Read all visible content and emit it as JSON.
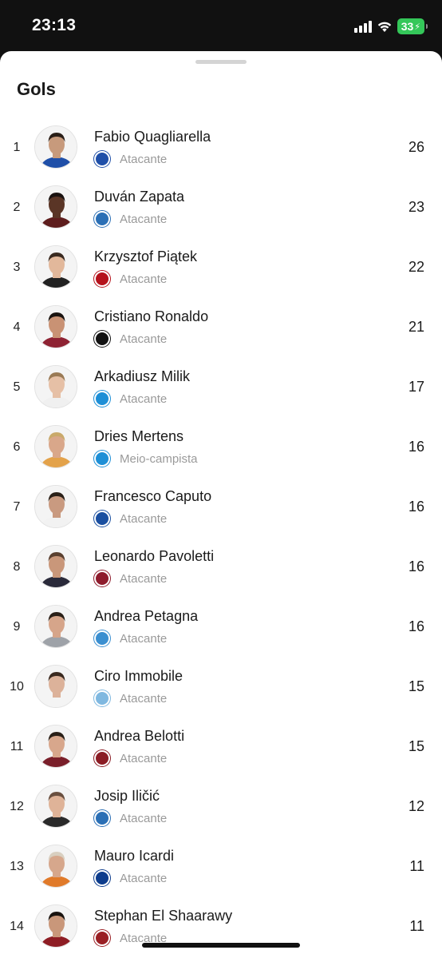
{
  "status": {
    "time": "23:13",
    "battery": "33"
  },
  "sheet": {
    "title": "Gols"
  },
  "players": [
    {
      "rank": "1",
      "name": "Fabio Quagliarella",
      "position": "Atacante",
      "goals": "26",
      "club_color": "#1f4fa8",
      "club_icon": "sampdoria-crest-icon",
      "skin": "#c79a7c",
      "hair": "#2a1f18",
      "shirt": "#1f4fa8"
    },
    {
      "rank": "2",
      "name": "Duván Zapata",
      "position": "Atacante",
      "goals": "23",
      "club_color": "#2b6fb5",
      "club_icon": "atalanta-crest-icon",
      "skin": "#5a3526",
      "hair": "#1a1210",
      "shirt": "#5e1d1d"
    },
    {
      "rank": "3",
      "name": "Krzysztof Piątek",
      "position": "Atacante",
      "goals": "22",
      "club_color": "#b5121b",
      "club_icon": "milan-crest-icon",
      "skin": "#e2b89b",
      "hair": "#3a2a20",
      "shirt": "#222222"
    },
    {
      "rank": "4",
      "name": "Cristiano Ronaldo",
      "position": "Atacante",
      "goals": "21",
      "club_color": "#111111",
      "club_icon": "juventus-crest-icon",
      "skin": "#c99274",
      "hair": "#1a1410",
      "shirt": "#8e2233"
    },
    {
      "rank": "5",
      "name": "Arkadiusz Milik",
      "position": "Atacante",
      "goals": "17",
      "club_color": "#1e8fd6",
      "club_icon": "napoli-crest-icon",
      "skin": "#e6c0a6",
      "hair": "#9a7a55",
      "shirt": "#f0f0f0"
    },
    {
      "rank": "6",
      "name": "Dries Mertens",
      "position": "Meio-campista",
      "goals": "16",
      "club_color": "#1e8fd6",
      "club_icon": "napoli-crest-icon",
      "skin": "#d9a78a",
      "hair": "#c9a96a",
      "shirt": "#e3a24a"
    },
    {
      "rank": "7",
      "name": "Francesco Caputo",
      "position": "Atacante",
      "goals": "16",
      "club_color": "#1a4fa0",
      "club_icon": "empoli-crest-icon",
      "skin": "#c99a80",
      "hair": "#2a2018",
      "shirt": "#f2f2f2"
    },
    {
      "rank": "8",
      "name": "Leonardo Pavoletti",
      "position": "Atacante",
      "goals": "16",
      "club_color": "#8e1b2c",
      "club_icon": "cagliari-crest-icon",
      "skin": "#c9977a",
      "hair": "#5a4030",
      "shirt": "#2a2a3a"
    },
    {
      "rank": "9",
      "name": "Andrea Petagna",
      "position": "Atacante",
      "goals": "16",
      "club_color": "#3b8fd0",
      "club_icon": "spal-crest-icon",
      "skin": "#d6a58a",
      "hair": "#2a2018",
      "shirt": "#9ea2a8"
    },
    {
      "rank": "10",
      "name": "Ciro Immobile",
      "position": "Atacante",
      "goals": "15",
      "club_color": "#7fb8e0",
      "club_icon": "lazio-crest-icon",
      "skin": "#dcb29a",
      "hair": "#3a2a20",
      "shirt": "#f4f4f4"
    },
    {
      "rank": "11",
      "name": "Andrea Belotti",
      "position": "Atacante",
      "goals": "15",
      "club_color": "#8b1c24",
      "club_icon": "torino-crest-icon",
      "skin": "#d8a78c",
      "hair": "#2a2018",
      "shirt": "#7a1f2a"
    },
    {
      "rank": "12",
      "name": "Josip Iličić",
      "position": "Atacante",
      "goals": "12",
      "club_color": "#2b6fb5",
      "club_icon": "atalanta-crest-icon",
      "skin": "#dfb398",
      "hair": "#6a5040",
      "shirt": "#2a2a2a"
    },
    {
      "rank": "13",
      "name": "Mauro Icardi",
      "position": "Atacante",
      "goals": "11",
      "club_color": "#0d3c8c",
      "club_icon": "inter-crest-icon",
      "skin": "#d6a78c",
      "hair": "#d8cfc0",
      "shirt": "#e07a2a"
    },
    {
      "rank": "14",
      "name": "Stephan El Shaarawy",
      "position": "Atacante",
      "goals": "11",
      "club_color": "#9a1f24",
      "club_icon": "roma-crest-icon",
      "skin": "#c9977a",
      "hair": "#1a1410",
      "shirt": "#8e1d24"
    }
  ]
}
